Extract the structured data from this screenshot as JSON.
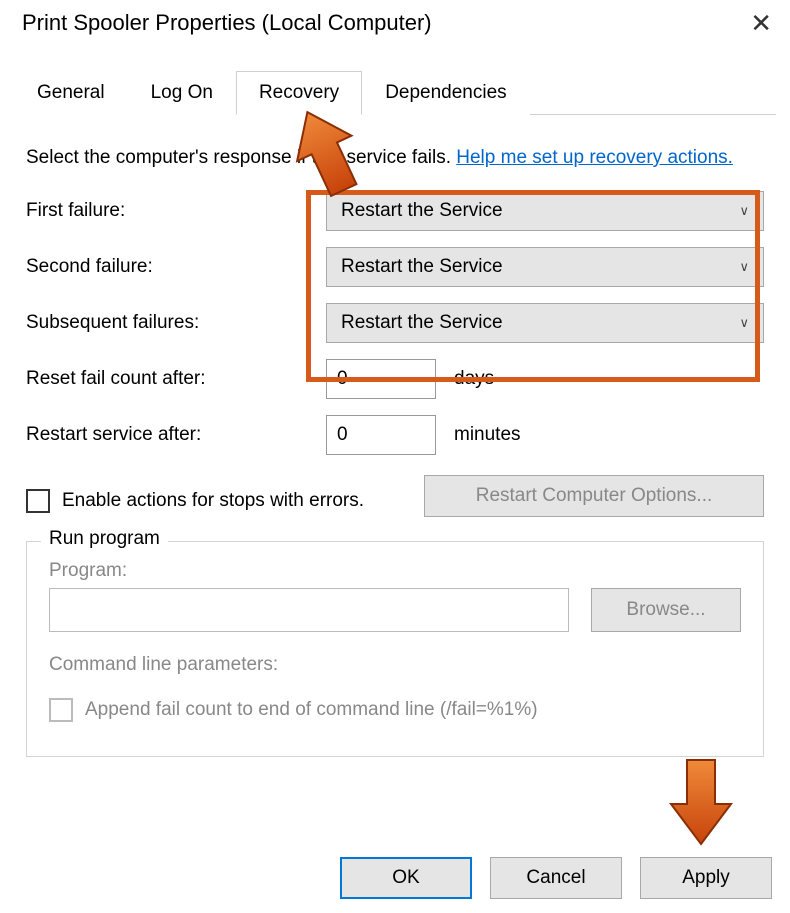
{
  "titlebar": {
    "title": "Print Spooler Properties (Local Computer)"
  },
  "tabs": {
    "general": "General",
    "logon": "Log On",
    "recovery": "Recovery",
    "dependencies": "Dependencies",
    "active": "recovery"
  },
  "intro": {
    "prefix": "Select the computer's response if this service fails. ",
    "link": "Help me set up recovery actions."
  },
  "failures": {
    "first": {
      "label": "First failure:",
      "value": "Restart the Service"
    },
    "second": {
      "label": "Second failure:",
      "value": "Restart the Service"
    },
    "subsequent": {
      "label": "Subsequent failures:",
      "value": "Restart the Service"
    }
  },
  "reset_fail": {
    "label": "Reset fail count after:",
    "value": "0",
    "unit": "days"
  },
  "restart_after": {
    "label": "Restart service after:",
    "value": "0",
    "unit": "minutes"
  },
  "enable_actions": {
    "label": "Enable actions for stops with errors.",
    "checked": false
  },
  "restart_computer_options": "Restart Computer Options...",
  "run_program": {
    "legend": "Run program",
    "program_label": "Program:",
    "program_value": "",
    "browse": "Browse...",
    "cmdline_label": "Command line parameters:",
    "cmdline_value": "",
    "append_label": "Append fail count to end of command line (/fail=%1%)",
    "append_checked": false
  },
  "buttons": {
    "ok": "OK",
    "cancel": "Cancel",
    "apply": "Apply"
  }
}
